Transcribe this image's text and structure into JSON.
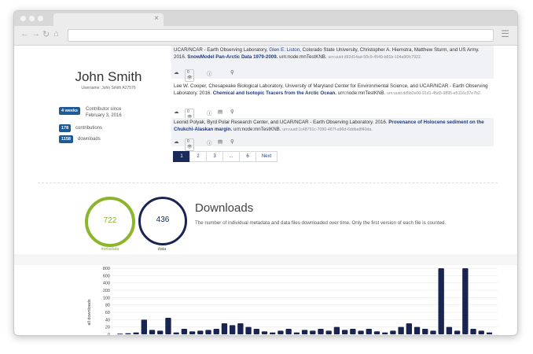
{
  "browser": {
    "tab_close": "×",
    "nav_icons": [
      "←",
      "→",
      "↻",
      "⌂"
    ],
    "menu_icon": "☰"
  },
  "profile": {
    "name": "John Smith",
    "subtitle": "Username: John Smith A27576",
    "contributor_badge": "4 weeks",
    "contributor_label_1": "Contributor since",
    "contributor_label_2": "February 3, 2016",
    "contributions_count": "178",
    "contributions_label": "contributions",
    "downloads_count": "1158",
    "downloads_label": "downloads"
  },
  "citations": [
    {
      "prefix": "UCAR/NCAR - Earth Observing Laboratory, ",
      "authors_link": "Glen E. Liston",
      "rest": ", Colorado State University, Christopher A. Hiemstra, Matthew Sturm, and US Army. 2016. ",
      "title": "SnowModel Pan-Arctic Data 1979-2009.",
      "node": " urn:node:mnTestKNB. ",
      "uuid": "urn:uuid:d92d14ad-50c9-4549-b81b-104a96fc7922.",
      "count": "0"
    },
    {
      "prefix": "Lee W. Cooper, Chesapeake Biological Laboratory, University of Maryland Center for Environmental Science, and UCAR/NCAR - Earth Observing Laboratory. 2016. ",
      "authors_link": "",
      "rest": "",
      "title": "Chemical and Isotopic Tracers from the Arctic Ocean.",
      "node": " urn:node:mnTestKNB. ",
      "uuid": "urn:uuid:dd5b2e00-91d1-45d3-9895-e5116c37e7b2.",
      "count": "0"
    },
    {
      "prefix": "Leonid Polyak, Byrd Polar Research Center, and UCAR/NCAR - Earth Observing Laboratory. 2016. ",
      "authors_link": "",
      "rest": "",
      "title": "Provenance of Holocene sediment on the Chukchi-Alaskan margin.",
      "node": " urn:node:mnTestKNB. ",
      "uuid": "urn:uuid:1c48791c-7090-487f-a96d-6ddba8f40da.",
      "count": "0"
    }
  ],
  "pagination": [
    "1",
    "2",
    "3",
    "...",
    "6",
    "Next"
  ],
  "metrics": {
    "metadata_value": "722",
    "metadata_label": "metadata",
    "data_value": "436",
    "data_label": "data",
    "metadata_color": "#8bb52b",
    "data_color": "#1a2450",
    "title": "Downloads",
    "description": "The number of individual metadata and data files downloaded over time. Only the first version of each file is counted."
  },
  "chart_data": {
    "type": "bar",
    "ylabel": "all downloads",
    "yticks": [
      0,
      20,
      40,
      60,
      80,
      100,
      200,
      400,
      600,
      800
    ],
    "categories": [],
    "values": [
      2,
      3,
      5,
      40,
      12,
      10,
      45,
      5,
      15,
      8,
      10,
      12,
      15,
      30,
      25,
      30,
      20,
      15,
      8,
      5,
      10,
      15,
      5,
      12,
      10,
      15,
      10,
      20,
      12,
      15,
      10,
      15,
      8,
      5,
      10,
      20,
      30,
      20,
      15,
      10,
      800,
      20,
      10,
      900,
      15,
      10,
      5
    ],
    "bar_color": "#1a2450",
    "grid": true,
    "legend": "none"
  }
}
